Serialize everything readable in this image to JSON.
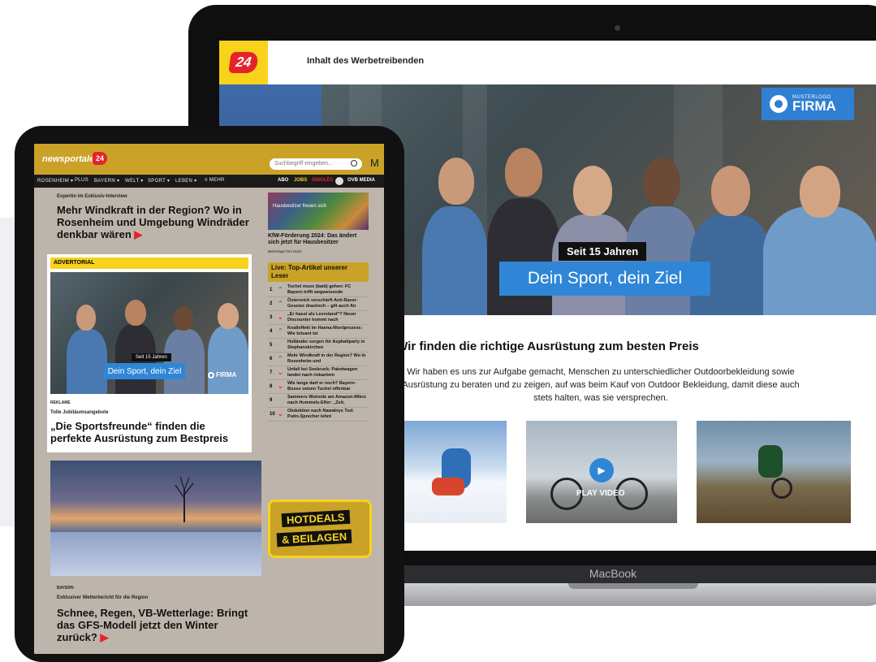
{
  "laptop": {
    "header_text": "Inhalt des Werbetreibenden",
    "logo_text": "24",
    "hero": {
      "brand_small": "MUSTERLOGO",
      "brand_big": "FIRMA",
      "tag": "Seit 15 Jahren",
      "title": "Dein Sport, dein Ziel"
    },
    "headline": "Wir finden die richtige Ausrüstung zum besten Preis",
    "body": "Wir haben es uns zur Aufgabe gemacht, Menschen zu unterschiedlicher Outdoorbekleidung sowie Ausrüstung zu beraten und zu zeigen, auf was beim Kauf von Outdoor Bekleidung, damit diese auch stets halten, was sie versprechen.",
    "video_label": "PLAY VIDEO",
    "device_label": "MacBook"
  },
  "tablet": {
    "logo_text": "newsportale",
    "logo_badge": "24",
    "search_placeholder": "Suchbegriff eingeben...",
    "header_right": "M",
    "nav": [
      "ROSENHEIM ▾",
      "PLUS",
      "BAYERN ▾",
      "WELT ▾",
      "SPORT ▾",
      "LEBEN ▾",
      "≡ MEHR"
    ],
    "nav_right": {
      "abo": "ABO",
      "jobs": "JOBS",
      "singles": "SINGLES",
      "brand": "OVB MEDIA"
    },
    "article1": {
      "kicker": "Expertin im Exklusiv-Interview",
      "title": "Mehr Windkraft in der Region? Wo in Rosenheim und Umgebung Windräder denkbar wären"
    },
    "advert": {
      "bar": "ADVERTORIAL",
      "tag": "Seit 15 Jahren",
      "title": "Dein Sport, dein Ziel",
      "brand": "FIRMA",
      "label": "REKLAME",
      "kicker": "Tolle Jubiläumsangebote",
      "headline": "„Die Sportsfreunde“ finden die perfekte Ausrüstung zum Bestpreis"
    },
    "article2": {
      "section": "BAYERN",
      "kicker": "Exklusiver Wetterbericht für die Region",
      "title": "Schnee, Regen, VB-Wetterlage: Bringt das GFS-Modell jetzt den Winter zurück?"
    },
    "side": {
      "img_caption": "Hausbesitzer freuen sich",
      "article_title": "KfW-Förderung 2024: Das ändert sich jetzt für Hausbesitzer",
      "article_sub": "Beilenlage fürs Dach",
      "live_title": "Live: Top-Artikel unserer Leser",
      "trends": [
        {
          "num": "1",
          "dir": "up",
          "text": "Tuchel muss (bald) gehen: FC Bayern trifft wegweisende"
        },
        {
          "num": "2",
          "dir": "up",
          "text": "Österreich verschärft Anti-Raser-Gesetze drastisch – gilt auch für"
        },
        {
          "num": "3",
          "dir": "down",
          "text": "„Er hasst als Leerstand“? Neuer Discounter kommt nach"
        },
        {
          "num": "4",
          "dir": "up",
          "text": "Knalleffekt im Hanna-Mordprozess: Wie brisant ist"
        },
        {
          "num": "5",
          "dir": "none",
          "text": "Holländer sorgen für Asphaltparty in Stephanskirchen"
        },
        {
          "num": "6",
          "dir": "up",
          "text": "Mehr Windkraft in der Region? Wo in Rosenheim und"
        },
        {
          "num": "7",
          "dir": "down",
          "text": "Unfall bei Seebruck: Paketwagen landet nach riskantem"
        },
        {
          "num": "8",
          "dir": "down",
          "text": "Wie lange darf er noch? Bayern-Bosse setzen Tuchel offenbar"
        },
        {
          "num": "9",
          "dir": "none",
          "text": "Sammers Wutrede am Amazon-Mikro nach Hummels-Elfer: „Zeit,"
        },
        {
          "num": "10",
          "dir": "down",
          "text": "Obduktion nach Nawalnys Tod: Putin-Sprecher lehnt"
        }
      ],
      "hotdeals_1": "HOTDEALS",
      "hotdeals_2": "& BEILAGEN"
    }
  },
  "colors": {
    "brand_yellow": "#f7d31c",
    "tablet_gold": "#c9a227",
    "accent_blue": "#2f86d6",
    "logo_red": "#e4232b"
  }
}
